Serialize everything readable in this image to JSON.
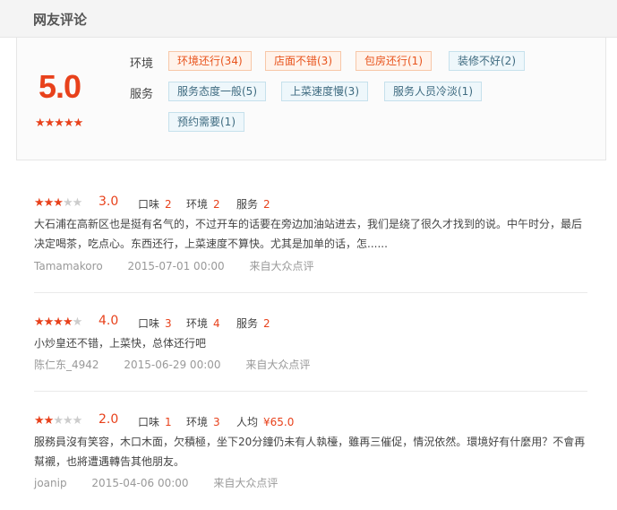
{
  "header": {
    "title": "网友评论"
  },
  "summary": {
    "score": "5.0",
    "stars": "★★★★★",
    "env_label": "环境",
    "service_label": "服务",
    "env_tags": [
      {
        "text": "环境还行(34)",
        "tone": "positive"
      },
      {
        "text": "店面不错(3)",
        "tone": "positive"
      },
      {
        "text": "包房还行(1)",
        "tone": "positive"
      },
      {
        "text": "装修不好(2)",
        "tone": "negative"
      }
    ],
    "service_tags": [
      {
        "text": "服务态度一般(5)",
        "tone": "negative"
      },
      {
        "text": "上菜速度慢(3)",
        "tone": "negative"
      },
      {
        "text": "服务人员冷淡(1)",
        "tone": "negative"
      },
      {
        "text": "预约需要(1)",
        "tone": "negative"
      }
    ]
  },
  "reviews": [
    {
      "rating": 3,
      "score": "3.0",
      "stars_on": "★★★",
      "stars_off": "★★",
      "m1_label": "口味",
      "m1_value": "2",
      "m2_label": "环境",
      "m2_value": "2",
      "m3_label": "服务",
      "m3_value": "2",
      "text": "大石浦在高新区也是挺有名气的，不过开车的话要在旁边加油站进去，我们是绕了很久才找到的说。中午时分，最后决定喝茶，吃点心。东西还行，上菜速度不算快。尤其是加单的话，怎......",
      "user": "Tamamakoro",
      "date": "2015-07-01 00:00",
      "source": "来自大众点评"
    },
    {
      "rating": 4,
      "score": "4.0",
      "stars_on": "★★★★",
      "stars_off": "★",
      "m1_label": "口味",
      "m1_value": "3",
      "m2_label": "环境",
      "m2_value": "4",
      "m3_label": "服务",
      "m3_value": "2",
      "text": "小炒皇还不错，上菜快，总体还行吧",
      "user": "陈仁东_4942",
      "date": "2015-06-29 00:00",
      "source": "来自大众点评"
    },
    {
      "rating": 2,
      "score": "2.0",
      "stars_on": "★★",
      "stars_off": "★★★",
      "m1_label": "口味",
      "m1_value": "1",
      "m2_label": "环境",
      "m2_value": "3",
      "m3_label": "人均",
      "m3_value": "¥65.0",
      "text": "服務員沒有笑容，木口木面，欠積極，坐下20分鐘仍未有人執檯，雖再三催促，情況依然。環境好有什麼用？不會再幫襯，也將遭遇轉告其他朋友。",
      "user": "joanip",
      "date": "2015-04-06 00:00",
      "source": "来自大众点评"
    }
  ],
  "colors": {
    "accent": "#e8411b",
    "positive_tag_bg": "#fff3eb",
    "negative_tag_bg": "#eef7fb"
  }
}
